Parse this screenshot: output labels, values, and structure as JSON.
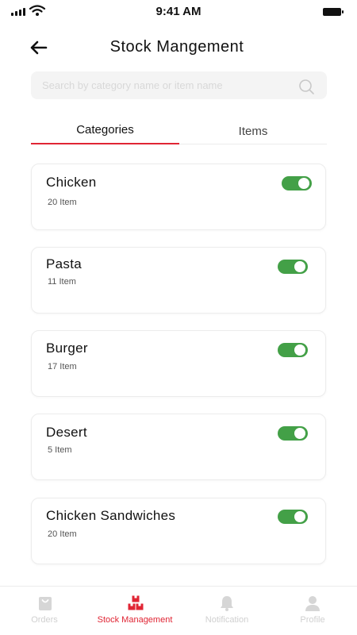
{
  "status_bar": {
    "time": "9:41 AM"
  },
  "header": {
    "title": "Stock Mangement"
  },
  "search": {
    "placeholder": "Search by category name or item name"
  },
  "tabs": [
    {
      "label": "Categories",
      "active": true
    },
    {
      "label": "Items",
      "active": false
    }
  ],
  "categories": [
    {
      "name": "Chicken",
      "count": "20 Item",
      "enabled": true
    },
    {
      "name": "Pasta",
      "count": "11 Item",
      "enabled": true
    },
    {
      "name": "Burger",
      "count": "17 Item",
      "enabled": true
    },
    {
      "name": "Desert",
      "count": "5 Item",
      "enabled": true
    },
    {
      "name": "Chicken Sandwiches",
      "count": "20 Item",
      "enabled": true
    }
  ],
  "bottom_nav": [
    {
      "label": "Orders",
      "icon": "shopping-bag-icon",
      "active": false
    },
    {
      "label": "Stock Management",
      "icon": "boxes-icon",
      "active": true
    },
    {
      "label": "Notification",
      "icon": "bell-icon",
      "active": false
    },
    {
      "label": "Profile",
      "icon": "person-icon",
      "active": false
    }
  ],
  "colors": {
    "accent": "#e02534",
    "toggle_on": "#43a047",
    "inactive": "#d0d0d0"
  }
}
